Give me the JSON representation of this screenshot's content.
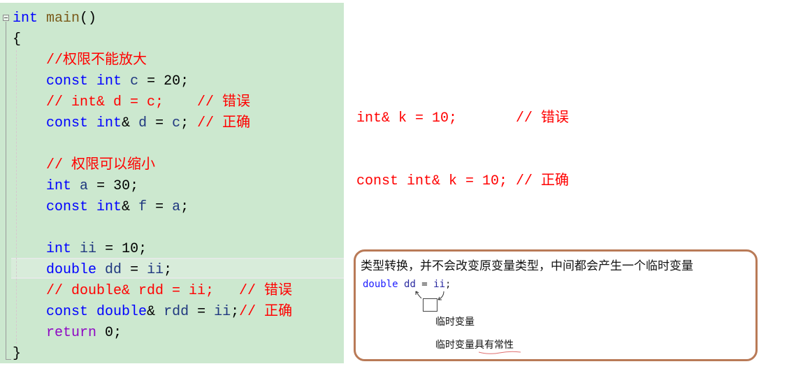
{
  "editor": {
    "background": "#cce8cf",
    "lines": [
      [
        {
          "t": "int",
          "c": "kw"
        },
        {
          "t": " ",
          "c": "pl"
        },
        {
          "t": "main",
          "c": "fn"
        },
        {
          "t": "()",
          "c": "pl"
        }
      ],
      [
        {
          "t": "{",
          "c": "pl"
        }
      ],
      [
        {
          "t": "    //权限不能放大",
          "c": "cm"
        }
      ],
      [
        {
          "t": "    ",
          "c": "pl"
        },
        {
          "t": "const",
          "c": "kw"
        },
        {
          "t": " ",
          "c": "pl"
        },
        {
          "t": "int",
          "c": "kw"
        },
        {
          "t": " ",
          "c": "pl"
        },
        {
          "t": "c",
          "c": "id"
        },
        {
          "t": " = ",
          "c": "pl"
        },
        {
          "t": "20",
          "c": "num"
        },
        {
          "t": ";",
          "c": "pl"
        }
      ],
      [
        {
          "t": "    // int& d = c;    // 错误",
          "c": "cm"
        }
      ],
      [
        {
          "t": "    ",
          "c": "pl"
        },
        {
          "t": "const",
          "c": "kw"
        },
        {
          "t": " ",
          "c": "pl"
        },
        {
          "t": "int",
          "c": "kw"
        },
        {
          "t": "& ",
          "c": "pl"
        },
        {
          "t": "d",
          "c": "id"
        },
        {
          "t": " = ",
          "c": "pl"
        },
        {
          "t": "c",
          "c": "id"
        },
        {
          "t": "; ",
          "c": "pl"
        },
        {
          "t": "// 正确",
          "c": "cm"
        }
      ],
      [
        {
          "t": "",
          "c": "pl"
        }
      ],
      [
        {
          "t": "    // 权限可以缩小",
          "c": "cm"
        }
      ],
      [
        {
          "t": "    ",
          "c": "pl"
        },
        {
          "t": "int",
          "c": "kw"
        },
        {
          "t": " ",
          "c": "pl"
        },
        {
          "t": "a",
          "c": "id"
        },
        {
          "t": " = ",
          "c": "pl"
        },
        {
          "t": "30",
          "c": "num"
        },
        {
          "t": ";",
          "c": "pl"
        }
      ],
      [
        {
          "t": "    ",
          "c": "pl"
        },
        {
          "t": "const",
          "c": "kw"
        },
        {
          "t": " ",
          "c": "pl"
        },
        {
          "t": "int",
          "c": "kw"
        },
        {
          "t": "& ",
          "c": "pl"
        },
        {
          "t": "f",
          "c": "id"
        },
        {
          "t": " = ",
          "c": "pl"
        },
        {
          "t": "a",
          "c": "id"
        },
        {
          "t": ";",
          "c": "pl"
        }
      ],
      [
        {
          "t": "",
          "c": "pl"
        }
      ],
      [
        {
          "t": "    ",
          "c": "pl"
        },
        {
          "t": "int",
          "c": "kw"
        },
        {
          "t": " ",
          "c": "pl"
        },
        {
          "t": "ii",
          "c": "id"
        },
        {
          "t": " = ",
          "c": "pl"
        },
        {
          "t": "10",
          "c": "num"
        },
        {
          "t": ";",
          "c": "pl"
        }
      ],
      [
        {
          "t": "    ",
          "c": "pl"
        },
        {
          "t": "double",
          "c": "kw"
        },
        {
          "t": " ",
          "c": "pl"
        },
        {
          "t": "dd",
          "c": "id"
        },
        {
          "t": " = ",
          "c": "pl"
        },
        {
          "t": "ii",
          "c": "id"
        },
        {
          "t": ";",
          "c": "pl"
        }
      ],
      [
        {
          "t": "    // double& rdd = ii;   // 错误",
          "c": "cm"
        }
      ],
      [
        {
          "t": "    ",
          "c": "pl"
        },
        {
          "t": "const",
          "c": "kw"
        },
        {
          "t": " ",
          "c": "pl"
        },
        {
          "t": "double",
          "c": "kw"
        },
        {
          "t": "& ",
          "c": "pl"
        },
        {
          "t": "rdd",
          "c": "id"
        },
        {
          "t": " = ",
          "c": "pl"
        },
        {
          "t": "ii",
          "c": "id"
        },
        {
          "t": ";",
          "c": "pl"
        },
        {
          "t": "// 正确",
          "c": "cm"
        }
      ],
      [
        {
          "t": "    ",
          "c": "pl"
        },
        {
          "t": "return",
          "c": "ret"
        },
        {
          "t": " ",
          "c": "pl"
        },
        {
          "t": "0",
          "c": "num"
        },
        {
          "t": ";",
          "c": "pl"
        }
      ],
      [
        {
          "t": "}",
          "c": "pl"
        }
      ]
    ],
    "current_line_index": 12
  },
  "notes": {
    "line1": "int& k = 10;       // 错误",
    "line2": "const int& k = 10; // 正确"
  },
  "callout": {
    "border_color": "#b97a57",
    "title": "类型转换，并不会改变原变量类型，中间都会产生一个临时变量",
    "code_keyword": "double",
    "code_lhs": "dd",
    "code_op": " = ",
    "code_rhs": "ii",
    "code_end": ";",
    "temp_label": "临时变量",
    "const_label": "临时变量具有常性"
  }
}
